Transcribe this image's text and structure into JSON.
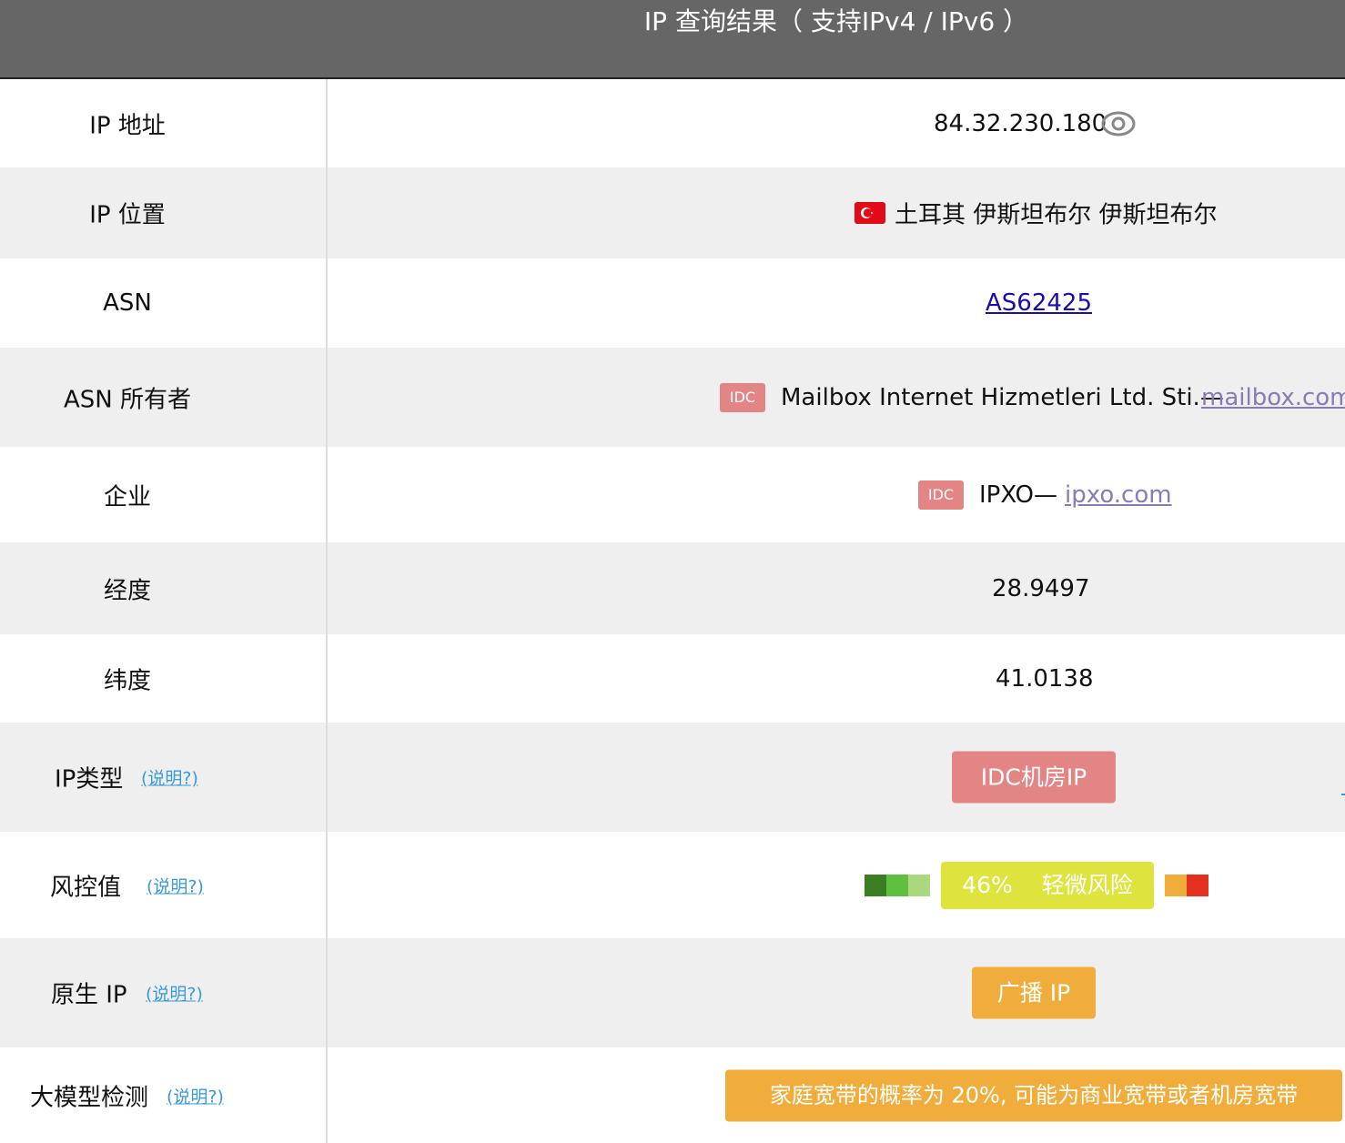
{
  "header": {
    "title": "IP 查询结果（ 支持IPv4 / IPv6 ）"
  },
  "rows": {
    "ip_address": {
      "label": "IP 地址",
      "value": "84.32.230.180",
      "icon": "eye-icon"
    },
    "ip_location": {
      "label": "IP 位置",
      "flag": "turkey-flag",
      "value": "土耳其 伊斯坦布尔 伊斯坦布尔"
    },
    "asn": {
      "label": "ASN",
      "value": "AS62425"
    },
    "asn_owner": {
      "label": "ASN 所有者",
      "tag": "IDC",
      "name": "Mailbox Internet Hizmetleri Ltd. Sti.—",
      "link": "mailbox.com."
    },
    "company": {
      "label": "企业",
      "tag": "IDC",
      "name": "IPXO—",
      "link": "ipxo.com"
    },
    "longitude": {
      "label": "经度",
      "value": "28.9497"
    },
    "latitude": {
      "label": "纬度",
      "value": "41.0138"
    },
    "ip_type": {
      "label": "IP类型",
      "help": "(说明?)",
      "value": "IDC机房IP",
      "color": "#e38585"
    },
    "risk": {
      "label": "风控值",
      "help": "(说明?)",
      "percent": 46,
      "percent_text": "46%",
      "level": "轻微风险",
      "scale_colors": [
        "#3a7d23",
        "#5fbf3f",
        "#a9d87e",
        "#dfe33d",
        "#f0ad3c",
        "#e3301f"
      ]
    },
    "native_ip": {
      "label": "原生 IP",
      "help": "(说明?)",
      "value": "广播 IP",
      "color": "#f0ad3c"
    },
    "llm_detect": {
      "label": "大模型检测",
      "help": "(说明?)",
      "value": "家庭宽带的概率为 20%, 可能为商业宽带或者机房宽带",
      "color": "#f0ad3c"
    }
  }
}
